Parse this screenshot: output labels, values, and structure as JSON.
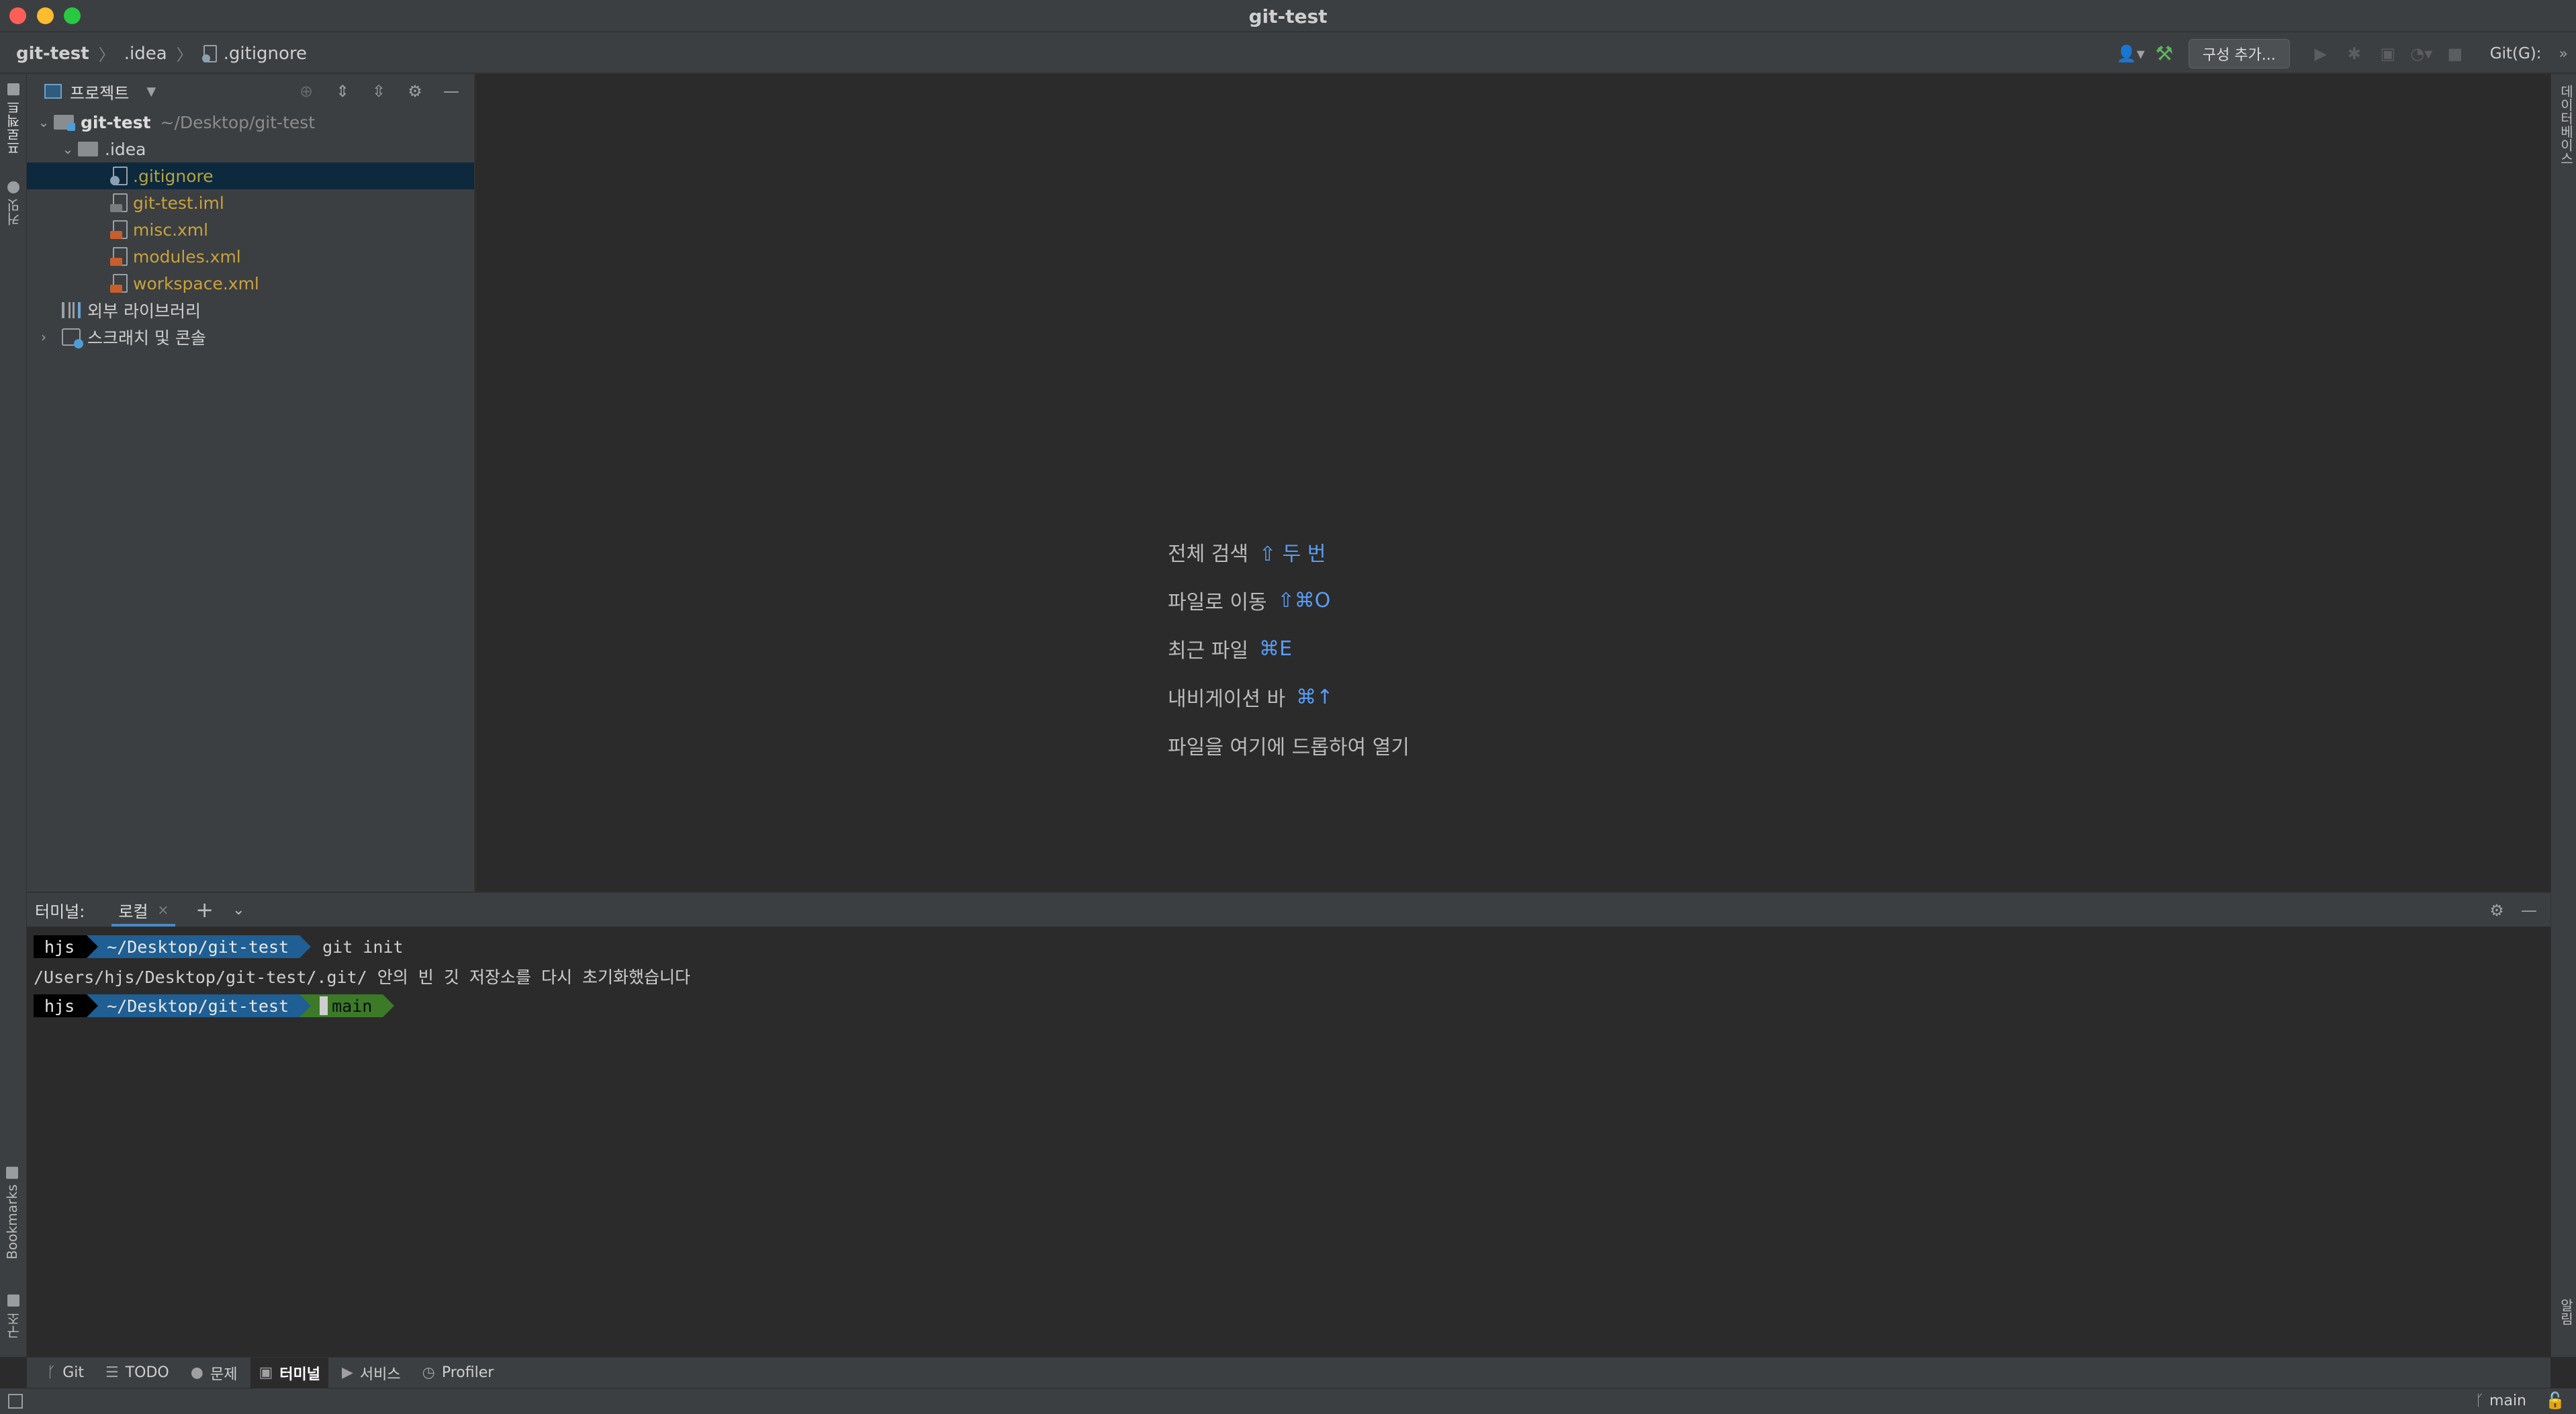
{
  "window": {
    "title": "git-test"
  },
  "breadcrumb": {
    "project": "git-test",
    "folder": ".idea",
    "file": ".gitignore"
  },
  "navbar": {
    "config_button": "구성 추가...",
    "git_label": "Git(G):"
  },
  "left_stripe": {
    "project_tab": "프로젝트",
    "commit_tab": "커밋",
    "bookmarks_tab": "Bookmarks",
    "structure_tab": "구조"
  },
  "right_stripe": {
    "database_tab": "데이터베이스",
    "notifications_tab": "알림"
  },
  "project_panel": {
    "title": "프로젝트",
    "root": {
      "name": "git-test",
      "path": "~/Desktop/git-test"
    },
    "idea_folder": ".idea",
    "files": [
      {
        "name": ".gitignore"
      },
      {
        "name": "git-test.iml"
      },
      {
        "name": "misc.xml"
      },
      {
        "name": "modules.xml"
      },
      {
        "name": "workspace.xml"
      }
    ],
    "external_libraries": "외부 라이브러리",
    "scratches": "스크래치 및 콘솔"
  },
  "editor_hints": [
    {
      "text": "전체 검색",
      "shortcut": "⇧ 두 번"
    },
    {
      "text": "파일로 이동",
      "shortcut": "⇧⌘O"
    },
    {
      "text": "최근 파일",
      "shortcut": "⌘E"
    },
    {
      "text": "내비게이션 바",
      "shortcut": "⌘↑"
    },
    {
      "text": "파일을 여기에 드롭하여 열기",
      "shortcut": ""
    }
  ],
  "terminal": {
    "label": "터미널:",
    "tab": "로컬",
    "lines": [
      {
        "user": "hjs",
        "path": "~/Desktop/git-test",
        "command": "git init"
      },
      {
        "output": "/Users/hjs/Desktop/git-test/.git/ 안의 빈 깃 저장소를 다시 초기화했습니다"
      },
      {
        "user": "hjs",
        "path": "~/Desktop/git-test",
        "branch": "main"
      }
    ]
  },
  "bottom_tabs": [
    {
      "label": "Git",
      "icon": "branch-icon"
    },
    {
      "label": "TODO",
      "icon": "list-icon"
    },
    {
      "label": "문제",
      "icon": "problems-icon"
    },
    {
      "label": "터미널",
      "icon": "terminal-icon",
      "active": true
    },
    {
      "label": "서비스",
      "icon": "services-icon"
    },
    {
      "label": "Profiler",
      "icon": "profiler-icon"
    }
  ],
  "statusbar": {
    "branch": "main"
  },
  "colors": {
    "accent": "#4a88c7",
    "shortcut": "#589df6",
    "selection": "#0d293e"
  }
}
